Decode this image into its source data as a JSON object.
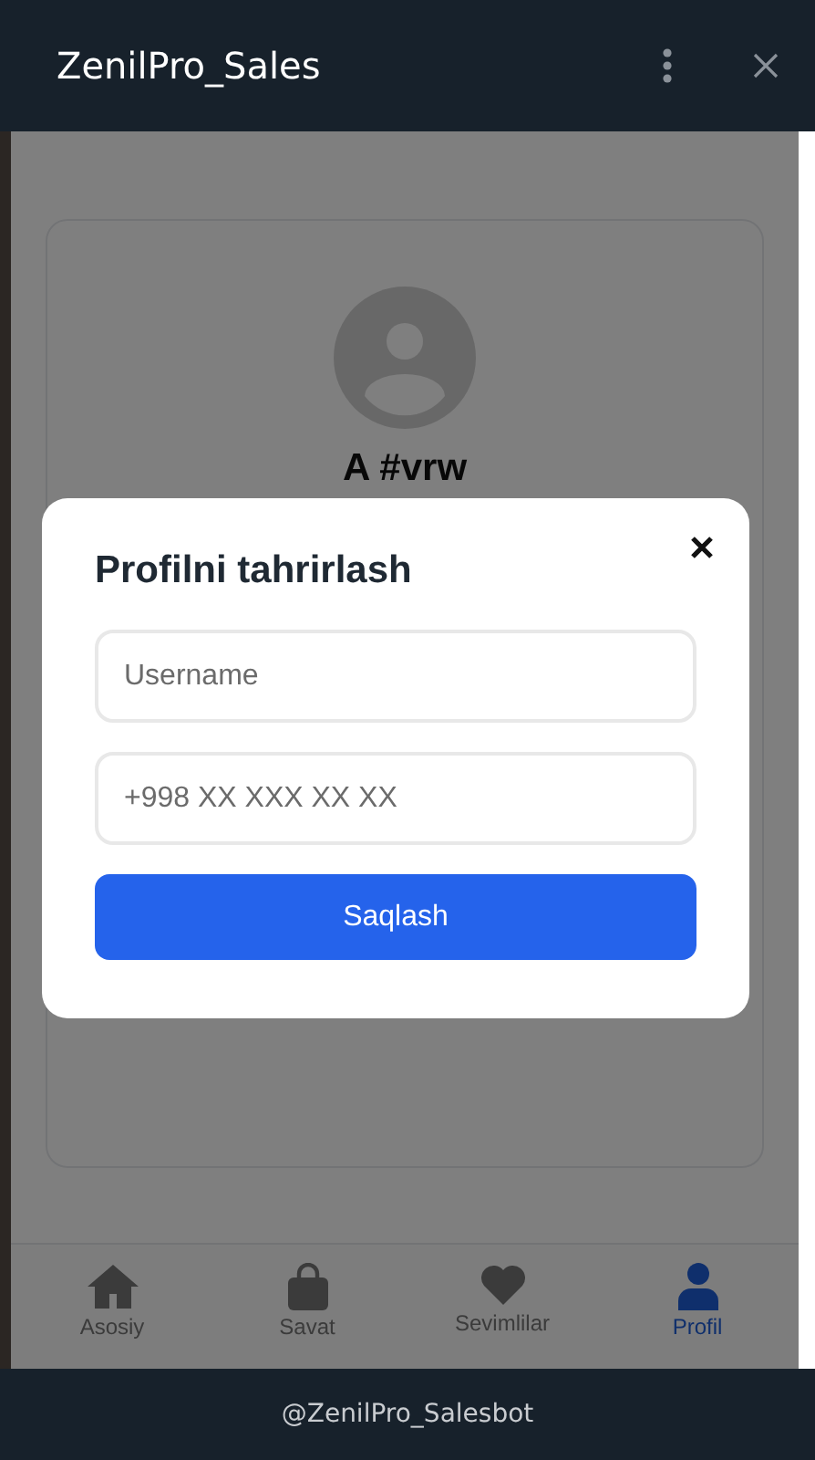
{
  "header": {
    "title": "ZenilPro_Sales"
  },
  "profile": {
    "name": "A #vrw"
  },
  "modal": {
    "title": "Profilni tahrirlash",
    "fields": [
      {
        "placeholder": "Username"
      },
      {
        "placeholder": "+998 XX XXX XX XX"
      }
    ],
    "button": "Saqlash"
  },
  "nav": [
    {
      "label": "Asosiy",
      "selected": false
    },
    {
      "label": "Savat",
      "selected": false
    },
    {
      "label": "Sevimlilar",
      "selected": false
    },
    {
      "label": "Profil",
      "selected": true
    }
  ],
  "footer": {
    "text": "@ZenilPro_Salesbot"
  }
}
